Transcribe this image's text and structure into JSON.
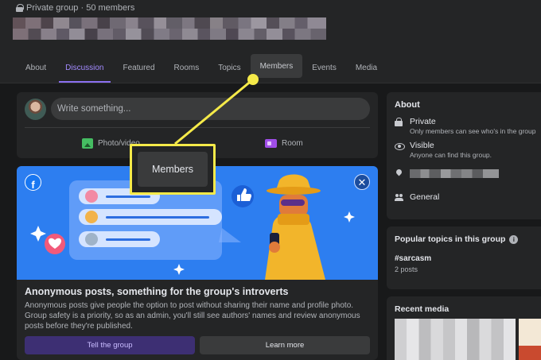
{
  "header": {
    "privacy_label": "Private group · 50 members",
    "tabs": [
      {
        "label": "About"
      },
      {
        "label": "Discussion"
      },
      {
        "label": "Featured"
      },
      {
        "label": "Rooms"
      },
      {
        "label": "Topics"
      },
      {
        "label": "Members"
      },
      {
        "label": "Events"
      },
      {
        "label": "Media"
      }
    ],
    "active_tab": "Discussion",
    "highlighted_tab": "Members"
  },
  "composer": {
    "placeholder": "Write something...",
    "photo_label": "Photo/video",
    "room_label": "Room"
  },
  "promo": {
    "title": "Anonymous posts, something for the group's introverts",
    "body": "Anonymous posts give people the option to post without sharing their name and profile photo. Group safety is a priority, so as an admin, you'll still see authors' names and review anonymous posts before they're published.",
    "primary_button": "Tell the group",
    "secondary_button": "Learn more",
    "close_symbol": "✕",
    "brand_letter": "f"
  },
  "about": {
    "title": "About",
    "private_label": "Private",
    "private_desc": "Only members can see who's in the group",
    "visible_label": "Visible",
    "visible_desc": "Anyone can find this group.",
    "category": "General"
  },
  "topics": {
    "title": "Popular topics in this group",
    "info_symbol": "i",
    "tag": "#sarcasm",
    "count": "2 posts"
  },
  "media": {
    "title": "Recent media"
  },
  "callout": {
    "label": "Members"
  },
  "colors": {
    "accent": "#8b6ff0",
    "highlight_yellow": "#f5ea49",
    "banner_blue": "#2d7ef0"
  }
}
